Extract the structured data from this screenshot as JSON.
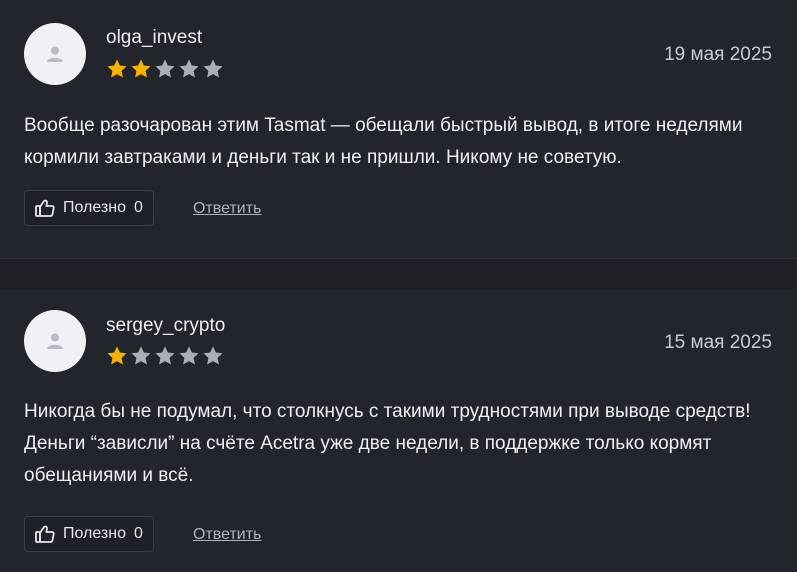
{
  "colors": {
    "background": "#22252c",
    "star_filled": "#f5b301",
    "star_empty": "#a9aeb8",
    "avatar_bg": "#f0f1f4",
    "avatar_icon": "#b7bcc6"
  },
  "reviews": [
    {
      "username": "olga_invest",
      "date": "19 мая 2025",
      "rating": 2,
      "max_rating": 5,
      "text": "Вообще разочарован этим Tasmat — обещали быстрый вывод, в итоге неделями кормили завтраками и деньги так и не пришли. Никому не советую.",
      "helpful_label": "Полезно",
      "helpful_count": "0",
      "reply_label": "Ответить",
      "avatar_icon": "user-icon",
      "helpful_icon": "thumbs-up-icon"
    },
    {
      "username": "sergey_crypto",
      "date": "15 мая 2025",
      "rating": 1,
      "max_rating": 5,
      "text": "Никогда бы не подумал, что столкнусь с такими трудностями при выводе средств! Деньги “зависли” на счёте Acetra уже две недели, в поддержке только кормят обещаниями и всё.",
      "helpful_label": "Полезно",
      "helpful_count": "0",
      "reply_label": "Ответить",
      "avatar_icon": "user-icon",
      "helpful_icon": "thumbs-up-icon"
    }
  ]
}
